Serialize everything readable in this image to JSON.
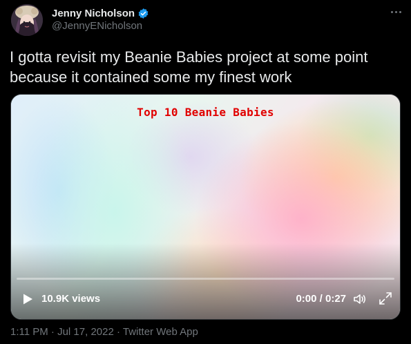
{
  "author": {
    "display_name": "Jenny Nicholson",
    "handle": "@JennyENicholson",
    "verified": true
  },
  "tweet": {
    "text": "I gotta revisit my Beanie Babies project at some point because it contained some my finest work"
  },
  "video": {
    "overlay_title": "Top 10 Beanie Babies",
    "views": "10.9K views",
    "time": "0:00 / 0:27",
    "progress": 0
  },
  "meta": {
    "timestamp": "1:11 PM · Jul 17, 2022 · ",
    "source": "Twitter Web App"
  },
  "colors": {
    "background": "#000000",
    "text": "#e7e9ea",
    "secondary": "#71767b",
    "verified_badge": "#1d9bf0",
    "overlay_title": "#e10000"
  },
  "icons": {
    "verified": "verified-badge-icon",
    "more": "more-dots-icon",
    "play": "play-icon",
    "volume": "volume-icon",
    "fullscreen": "fullscreen-icon"
  }
}
